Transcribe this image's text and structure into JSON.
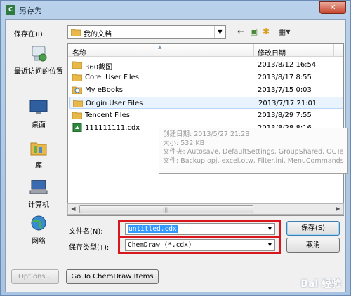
{
  "window": {
    "title": "另存为",
    "close_label": "✕",
    "app_icon_label": "C"
  },
  "toolbar": {
    "save_in_label": "保存在(I):",
    "save_in_value": "我的文档",
    "back_glyph": "←",
    "up_glyph": "▣",
    "new_folder_glyph": "✱",
    "view_glyph": "▦▾"
  },
  "places": [
    {
      "label": "最近访问的位置",
      "icon": "recent-icon"
    },
    {
      "label": "桌面",
      "icon": "desktop-icon"
    },
    {
      "label": "库",
      "icon": "library-icon"
    },
    {
      "label": "计算机",
      "icon": "computer-icon"
    },
    {
      "label": "网络",
      "icon": "network-icon"
    }
  ],
  "list": {
    "col_name": "名称",
    "col_date": "修改日期",
    "rows": [
      {
        "name": "360截图",
        "date": "2013/8/12 16:54",
        "type": "folder"
      },
      {
        "name": "Corel User Files",
        "date": "2013/8/17 8:55",
        "type": "folder"
      },
      {
        "name": "My eBooks",
        "date": "2013/7/15 0:03",
        "type": "ebook"
      },
      {
        "name": "Origin User Files",
        "date": "2013/7/17 21:01",
        "type": "folder"
      },
      {
        "name": "Tencent Files",
        "date": "2013/8/29 7:55",
        "type": "folder"
      },
      {
        "name": "111111111.cdx",
        "date": "2013/8/28 8:16",
        "type": "cdx"
      }
    ]
  },
  "tooltip": {
    "line1": "创建日期: 2013/5/27 21:28",
    "line2": "大小: 532 KB",
    "line3": "文件夹: Autosave, DefaultSettings, GroupShared, OCTe",
    "line4": "文件: Backup.opj, excel.otw, Filter.ini, MenuCommands"
  },
  "form": {
    "filename_label": "文件名(N):",
    "filename_value": "untitled.cdx",
    "filetype_label": "保存类型(T):",
    "filetype_value": "ChemDraw (*.cdx)",
    "save_label": "保存(S)",
    "cancel_label": "取消",
    "options_label": "Options...",
    "goto_label": "Go To ChemDraw Items"
  },
  "watermark": "Bai 经验",
  "colors": {
    "highlight": "#d9161c",
    "selection": "#3399ff"
  }
}
